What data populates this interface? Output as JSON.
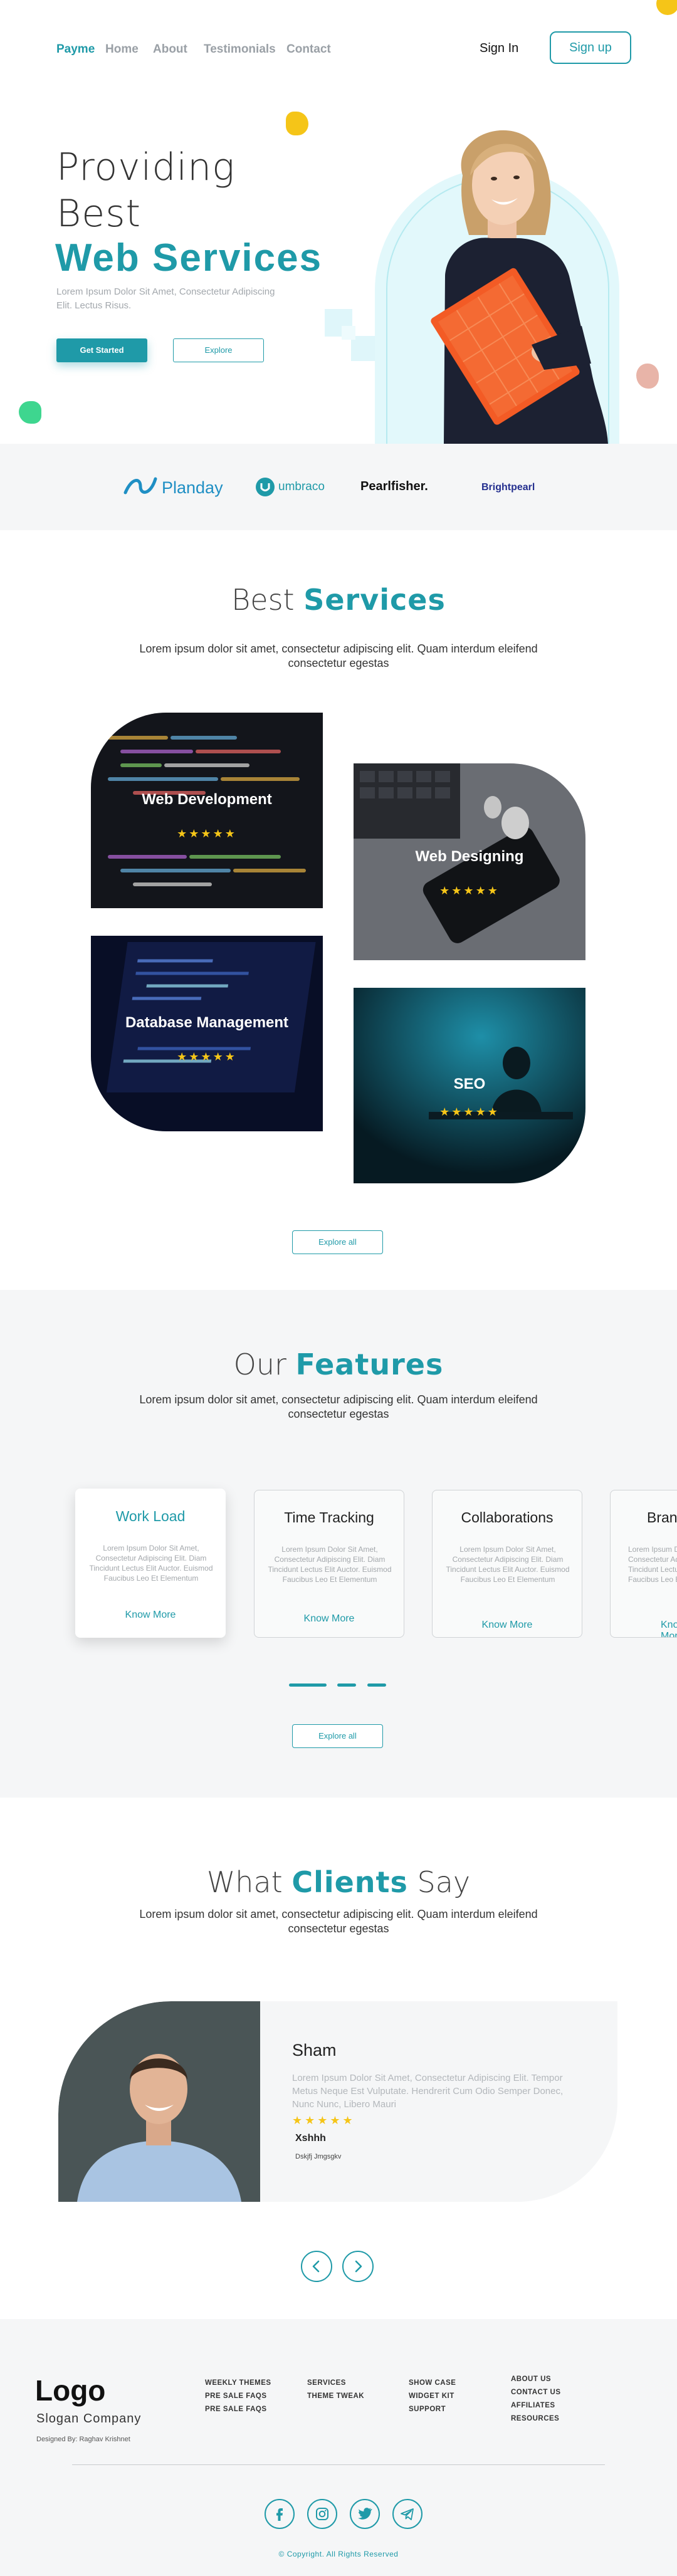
{
  "nav": {
    "brand": "Payme",
    "links": [
      "Home",
      "About",
      "Testimonials",
      "Contact"
    ],
    "signin": "Sign In",
    "signup": "Sign up"
  },
  "hero": {
    "line1": "Providing",
    "line2": "Best",
    "line3": "Web Services",
    "subtitle": "Lorem Ipsum Dolor Sit Amet, Consectetur Adipiscing Elit. Lectus Risus.",
    "cta_primary": "Get Started",
    "cta_secondary": "Explore"
  },
  "partners": [
    "Planday",
    "umbraco",
    "Pearlfisher.",
    "Brightpearl"
  ],
  "services": {
    "title_light": "Best",
    "title_bold": "Services",
    "subtitle": "Lorem ipsum dolor sit amet, consectetur adipiscing elit. Quam interdum eleifend consectetur egestas",
    "cards": [
      {
        "label": "Web Development",
        "stars": "★★★★★"
      },
      {
        "label": "Web Designing",
        "stars": "★★★★★"
      },
      {
        "label": "Database Management",
        "stars": "★★★★★"
      },
      {
        "label": "SEO",
        "stars": "★★★★★"
      }
    ],
    "explore": "Explore all"
  },
  "features": {
    "title_light": "Our",
    "title_bold": "Features",
    "subtitle": "Lorem ipsum dolor sit amet, consectetur adipiscing elit. Quam interdum eleifend consectetur egestas",
    "cards": [
      {
        "title": "Work Load",
        "text": "Lorem Ipsum Dolor Sit Amet, Consectetur Adipiscing Elit. Diam Tincidunt Lectus Elit Auctor. Euismod Faucibus Leo Et Elementum",
        "link": "Know More"
      },
      {
        "title": "Time Tracking",
        "text": "Lorem Ipsum Dolor Sit Amet, Consectetur Adipiscing Elit. Diam Tincidunt Lectus Elit Auctor. Euismod Faucibus Leo Et Elementum",
        "link": "Know More"
      },
      {
        "title": "Collaborations",
        "text": "Lorem Ipsum Dolor Sit Amet, Consectetur Adipiscing Elit. Diam Tincidunt Lectus Elit Auctor. Euismod Faucibus Leo Et Elementum",
        "link": "Know More"
      },
      {
        "title": "Brand",
        "text": "Lorem Ipsum Dolor Sit Amet, Consectetur Adipiscing Elit. Diam Tincidunt Lectus Elit Auctor. Euismod Faucibus Leo Et Elementum",
        "link": "Know More"
      }
    ],
    "explore": "Explore all"
  },
  "clients": {
    "title_light1": "What",
    "title_bold": "Clients",
    "title_light2": "Say",
    "subtitle": "Lorem ipsum dolor sit amet, consectetur adipiscing elit. Quam interdum eleifend consectetur egestas",
    "testimonial": {
      "name": "Sham",
      "text": "Lorem Ipsum Dolor Sit Amet, Consectetur Adipiscing Elit. Tempor Metus Neque Est Vulputate. Hendrerit Cum Odio Semper Donec, Nunc Nunc, Libero Mauri",
      "stars": "★★★★★",
      "signature": "Xshhh",
      "role": "Dskjfj Jmgsgkv"
    },
    "prev_icon": "chevron-left-icon",
    "next_icon": "chevron-right-icon"
  },
  "footer": {
    "logo": "Logo",
    "slogan": "Slogan Company",
    "designed_by": "Designed By: Raghav Krishnet",
    "col1": [
      "WEEKLY THEMES",
      "PRE SALE FAQS",
      "PRE SALE FAQS"
    ],
    "col2": [
      "SERVICES",
      "THEME TWEAK"
    ],
    "col3": [
      "SHOW CASE",
      "WIDGET KIT",
      "SUPPORT"
    ],
    "col4": [
      "ABOUT US",
      "CONTACT US",
      "AFFILIATES",
      "RESOURCES"
    ],
    "social": [
      "facebook-icon",
      "instagram-icon",
      "twitter-icon",
      "telegram-icon"
    ],
    "copyright": "© Copyright. All Rights Reserved"
  },
  "colors": {
    "accent": "#1f9aa8",
    "yellow": "#f5c518",
    "green": "#3ed68f",
    "bg_soft": "#f5f6f7"
  }
}
